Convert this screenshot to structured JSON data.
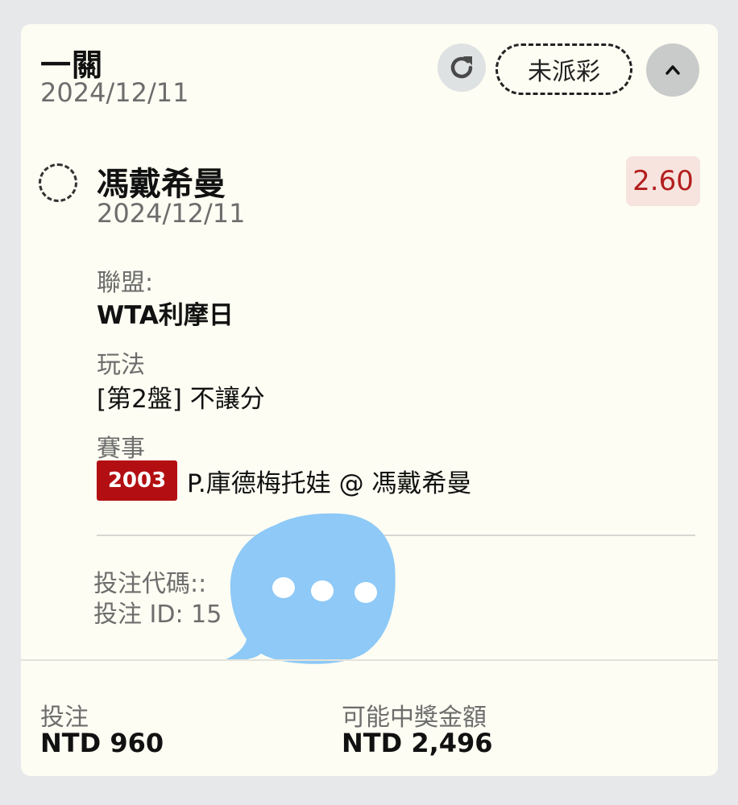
{
  "header": {
    "bet_type": "一關",
    "date": "2024/12/11",
    "status": "未派彩"
  },
  "selection": {
    "name": "馮戴希曼",
    "date": "2024/12/11",
    "odds": "2.60"
  },
  "details": {
    "league_label": "聯盟:",
    "league_value": "WTA利摩日",
    "play_label": "玩法",
    "play_value": "[第2盤] 不讓分",
    "event_label": "賽事",
    "event_code": "2003",
    "event_match": "P.庫德梅托娃 @ 馮戴希曼"
  },
  "bet_info": {
    "code_label": "投注代碼::",
    "id_label": "投注 ID: 15"
  },
  "footer": {
    "stake_label": "投注",
    "stake_value": "NTD 960",
    "payout_label": "可能中獎金額",
    "payout_value": "NTD 2,496"
  },
  "colors": {
    "card_bg": "#fdfdf3",
    "odds_text": "#b31e1e",
    "event_badge": "#b30f12",
    "chat_bubble": "#8ec9f7"
  },
  "icons": {
    "refresh": "refresh-icon",
    "collapse": "chevron-up-icon",
    "chat": "chat-bubble-icon"
  }
}
